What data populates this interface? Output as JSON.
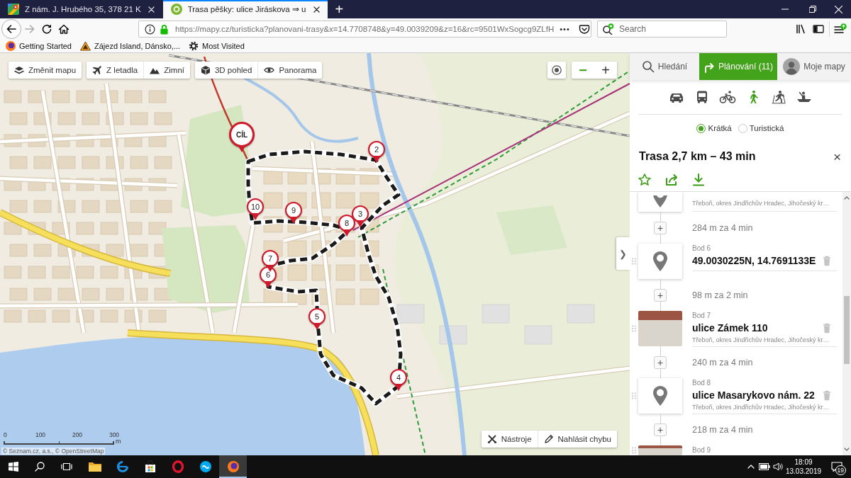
{
  "browser": {
    "tabs": [
      {
        "kind": "google-maps",
        "title": "Z nám. J. Hrubého 35, 378 21 K",
        "selected": false
      },
      {
        "kind": "mapy",
        "title": "Trasa pěšky: ulice Jiráskova ⇒ u",
        "selected": true
      }
    ],
    "new_tab": "+",
    "nav_buttons": [
      {
        "kind": "back",
        "disabled": false
      },
      {
        "kind": "forward",
        "disabled": true
      },
      {
        "kind": "reload",
        "disabled": false
      },
      {
        "kind": "home",
        "disabled": false
      }
    ],
    "url": "https://mapy.cz/turisticka?planovani-trasy&x=14.7708748&y=49.0039209&z=16&rc=9501WxSogcg9ZLfH",
    "page_actions": "•••",
    "search": {
      "placeholder": "Search"
    },
    "bookmarks": [
      {
        "kind": "firefox",
        "label": "Getting Started"
      },
      {
        "kind": "warning",
        "label": "Zájezd Island, Dánsko,..."
      },
      {
        "kind": "gear",
        "label": "Most Visited"
      }
    ]
  },
  "map": {
    "toolbar_groups": [
      {
        "buttons": [
          {
            "kind": "layers",
            "label": "Změnit mapu"
          }
        ]
      },
      {
        "buttons": [
          {
            "kind": "plane",
            "label": "Z letadla"
          },
          {
            "kind": "mountain",
            "label": "Zimní"
          }
        ]
      },
      {
        "buttons": [
          {
            "kind": "cube",
            "label": "3D pohled"
          },
          {
            "kind": "eye",
            "label": "Panorama"
          }
        ]
      }
    ],
    "zoom_out": "−",
    "zoom_in": "+",
    "markers": [
      {
        "kind": "finish",
        "label": "CÍL"
      },
      {
        "kind": "waypoint",
        "label": "2"
      },
      {
        "kind": "waypoint",
        "label": "3"
      },
      {
        "kind": "waypoint",
        "label": "4"
      },
      {
        "kind": "waypoint",
        "label": "5"
      },
      {
        "kind": "waypoint",
        "label": "6"
      },
      {
        "kind": "waypoint",
        "label": "7"
      },
      {
        "kind": "waypoint",
        "label": "8"
      },
      {
        "kind": "waypoint",
        "label": "9"
      },
      {
        "kind": "waypoint",
        "label": "10"
      }
    ],
    "panel_toggle": "❯",
    "tools": [
      {
        "kind": "tools",
        "label": "Nástroje"
      },
      {
        "kind": "pencil",
        "label": "Nahlásit chybu"
      }
    ],
    "scale": {
      "ticks": [
        "0",
        "100",
        "200",
        "300"
      ],
      "unit": "m"
    },
    "attribution": "© Seznam.cz, a.s., © OpenStreetMap"
  },
  "panel": {
    "tabs": [
      {
        "kind": "search",
        "label": "Hledání",
        "selected": false
      },
      {
        "kind": "route",
        "label": "Plánování (11)",
        "selected": true
      },
      {
        "kind": "avatar",
        "label": "Moje mapy",
        "selected": false
      }
    ],
    "modes": [
      {
        "kind": "car",
        "selected": false
      },
      {
        "kind": "bus",
        "selected": false
      },
      {
        "kind": "bike",
        "selected": false
      },
      {
        "kind": "walk",
        "selected": true
      },
      {
        "kind": "ski",
        "selected": false
      },
      {
        "kind": "boat",
        "selected": false
      }
    ],
    "route_types": [
      {
        "label": "Krátká",
        "selected": true
      },
      {
        "label": "Turistická",
        "selected": false
      }
    ],
    "route": {
      "title": "Trasa 2,7 km – 43 min",
      "close": "×"
    },
    "actions": [
      {
        "kind": "star"
      },
      {
        "kind": "share"
      },
      {
        "kind": "download"
      }
    ],
    "waypoints": [
      {
        "kind": "pin",
        "address": "Třeboň, okres Jindřichův Hradec, Jihočeský kr…"
      },
      {
        "kind": "segment",
        "add": "+",
        "distance": "284 m za 4 min"
      },
      {
        "kind": "pin",
        "label": "Bod 6",
        "title": "49.0030225N, 14.7691133E"
      },
      {
        "kind": "segment",
        "add": "+",
        "distance": "98 m za 2 min"
      },
      {
        "kind": "photo",
        "label": "Bod 7",
        "title": "ulice Zámek 110",
        "address": "Třeboň, okres Jindřichův Hradec, Jihočeský kr…"
      },
      {
        "kind": "segment",
        "add": "+",
        "distance": "240 m za 4 min"
      },
      {
        "kind": "pin",
        "label": "Bod 8",
        "title": "ulice Masarykovo nám. 22",
        "address": "Třeboň, okres Jindřichův Hradec, Jihočeský kr…"
      },
      {
        "kind": "segment",
        "add": "+",
        "distance": "218 m za 4 min"
      },
      {
        "kind": "photo",
        "label": "Bod 9"
      }
    ]
  },
  "taskbar": {
    "apps": [
      {
        "kind": "explorer",
        "selected": false
      },
      {
        "kind": "edge",
        "selected": false
      },
      {
        "kind": "store",
        "selected": false
      },
      {
        "kind": "opera",
        "selected": false
      },
      {
        "kind": "skype",
        "selected": false
      },
      {
        "kind": "firefox",
        "selected": true
      }
    ],
    "time": "18:09",
    "date": "13.03.2019",
    "notifications": "19"
  }
}
